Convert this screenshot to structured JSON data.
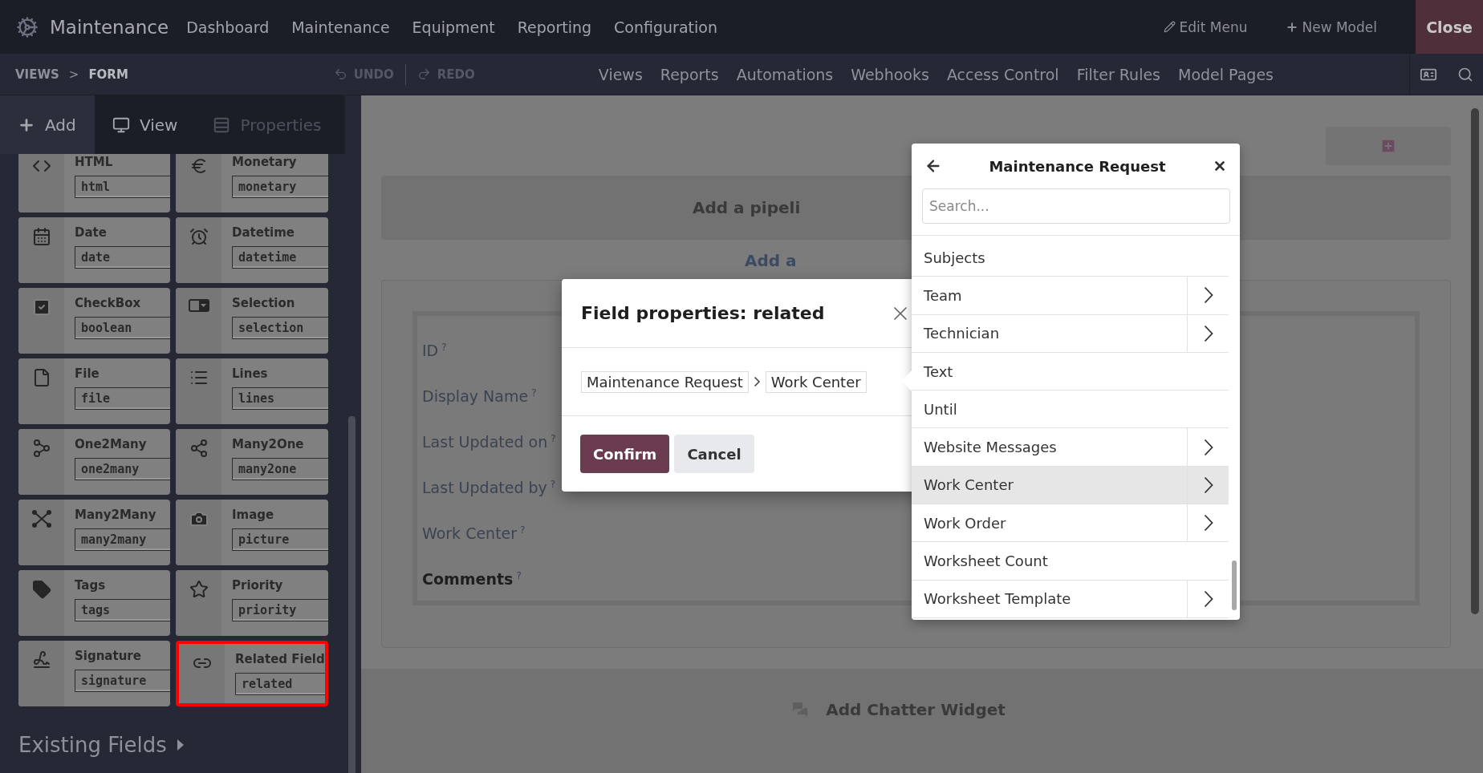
{
  "navbar": {
    "app_name": "Maintenance",
    "menus": [
      "Dashboard",
      "Maintenance",
      "Equipment",
      "Reporting",
      "Configuration"
    ],
    "actions": [
      {
        "label": "Edit Menu",
        "kind": "edit"
      },
      {
        "label": "New Model",
        "kind": "add"
      }
    ],
    "close": "Close"
  },
  "toolbar": {
    "breadcrumb": [
      "VIEWS",
      "FORM"
    ],
    "separator": ">",
    "undo": {
      "label": "UNDO",
      "disabled": true
    },
    "redo": {
      "label": "REDO",
      "disabled": true
    },
    "menus": [
      "Views",
      "Reports",
      "Automations",
      "Webhooks",
      "Access Control",
      "Filter Rules",
      "Model Pages"
    ]
  },
  "sidebar": {
    "tabs": [
      {
        "label": "Add",
        "kind": "add",
        "selected": true,
        "disabled": false
      },
      {
        "label": "View",
        "kind": "view",
        "selected": false,
        "disabled": false
      },
      {
        "label": "Properties",
        "kind": "properties",
        "selected": false,
        "disabled": true
      }
    ],
    "fields": [
      {
        "label": "HTML",
        "tech": "html",
        "kind": "html",
        "highlighted": false
      },
      {
        "label": "Monetary",
        "tech": "monetary",
        "kind": "monetary",
        "highlighted": false
      },
      {
        "label": "Date",
        "tech": "date",
        "kind": "date",
        "highlighted": false
      },
      {
        "label": "Datetime",
        "tech": "datetime",
        "kind": "datetime",
        "highlighted": false
      },
      {
        "label": "CheckBox",
        "tech": "boolean",
        "kind": "boolean",
        "highlighted": false
      },
      {
        "label": "Selection",
        "tech": "selection",
        "kind": "selection",
        "highlighted": false
      },
      {
        "label": "File",
        "tech": "file",
        "kind": "file",
        "highlighted": false
      },
      {
        "label": "Lines",
        "tech": "lines",
        "kind": "lines",
        "highlighted": false
      },
      {
        "label": "One2Many",
        "tech": "one2many",
        "kind": "one2many",
        "highlighted": false
      },
      {
        "label": "Many2One",
        "tech": "many2one",
        "kind": "many2one",
        "highlighted": false
      },
      {
        "label": "Many2Many",
        "tech": "many2many",
        "kind": "many2many",
        "highlighted": false
      },
      {
        "label": "Image",
        "tech": "picture",
        "kind": "image",
        "highlighted": false
      },
      {
        "label": "Tags",
        "tech": "tags",
        "kind": "tags",
        "highlighted": false
      },
      {
        "label": "Priority",
        "tech": "priority",
        "kind": "priority",
        "highlighted": false
      },
      {
        "label": "Signature",
        "tech": "signature",
        "kind": "signature",
        "highlighted": false
      },
      {
        "label": "Related Field",
        "tech": "related",
        "kind": "related",
        "highlighted": true
      }
    ],
    "existing_fields": "Existing Fields"
  },
  "form": {
    "pipeline": "Add a pipeli",
    "add_link": "Add a",
    "fields": [
      {
        "label": "ID",
        "help": "?",
        "required": false
      },
      {
        "label": "Display Name",
        "help": "?",
        "required": false
      },
      {
        "label": "Last Updated on",
        "help": "?",
        "required": false
      },
      {
        "label": "Last Updated by",
        "help": "?",
        "required": false
      },
      {
        "label": "Work Center",
        "help": "?",
        "required": false
      },
      {
        "label": "Comments",
        "help": "?",
        "required": true
      }
    ],
    "chatter": "Add Chatter Widget"
  },
  "dialog": {
    "title": "Field properties: related",
    "path": [
      "Maintenance Request",
      "Work Center"
    ],
    "buttons": [
      {
        "label": "Confirm",
        "kind": "primary"
      },
      {
        "label": "Cancel",
        "kind": "secondary"
      }
    ]
  },
  "popover": {
    "title": "Maintenance Request",
    "search": {
      "placeholder": "Search..."
    },
    "items": [
      {
        "label": "Subjects",
        "expandable": false,
        "selected": false
      },
      {
        "label": "Team",
        "expandable": true,
        "selected": false
      },
      {
        "label": "Technician",
        "expandable": true,
        "selected": false
      },
      {
        "label": "Text",
        "expandable": false,
        "selected": false
      },
      {
        "label": "Until",
        "expandable": false,
        "selected": false
      },
      {
        "label": "Website Messages",
        "expandable": true,
        "selected": false
      },
      {
        "label": "Work Center",
        "expandable": true,
        "selected": true
      },
      {
        "label": "Work Order",
        "expandable": true,
        "selected": false
      },
      {
        "label": "Worksheet Count",
        "expandable": false,
        "selected": false
      },
      {
        "label": "Worksheet Template",
        "expandable": true,
        "selected": false
      }
    ]
  }
}
